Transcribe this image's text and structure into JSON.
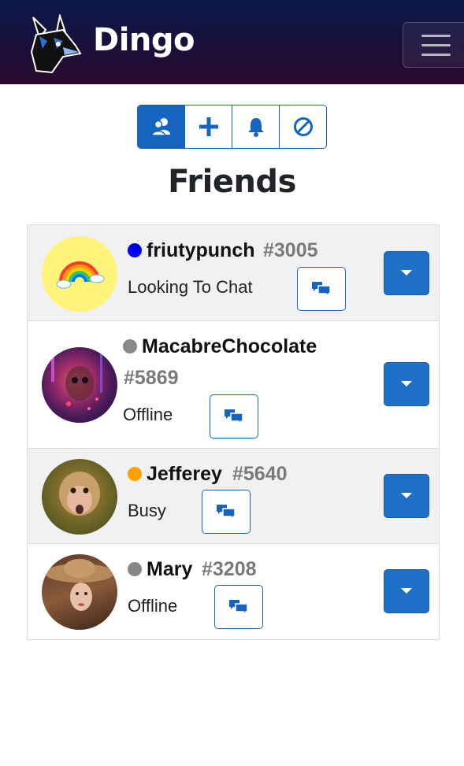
{
  "app": {
    "brand": "Dingo"
  },
  "navbar": {
    "menu_icon": "hamburger-icon",
    "logo_icon": "dingo-head-logo"
  },
  "tabs": [
    {
      "icon": "friends-icon",
      "active": true
    },
    {
      "icon": "plus-icon",
      "active": false
    },
    {
      "icon": "bell-icon",
      "active": false
    },
    {
      "icon": "blocked-icon",
      "active": false
    }
  ],
  "page": {
    "title": "Friends"
  },
  "friends": [
    {
      "name": "friutypunch",
      "tag": "#3005",
      "status": "Looking To Chat",
      "status_color": "#0000ee",
      "avatar": "rainbow-avatar"
    },
    {
      "name": "MacabreChocolate",
      "tag": "#5869",
      "status": "Offline",
      "status_color": "#888888",
      "avatar": "skull-neon-avatar"
    },
    {
      "name": "Jefferey",
      "tag": "#5640",
      "status": "Busy",
      "status_color": "#ffa000",
      "avatar": "monkey-avatar"
    },
    {
      "name": "Mary",
      "tag": "#3208",
      "status": "Offline",
      "status_color": "#888888",
      "avatar": "girl-hat-avatar"
    }
  ],
  "colors": {
    "primary": "#1565c0",
    "navbar_top": "#0b1a4a",
    "navbar_bottom": "#2a0a2e"
  }
}
